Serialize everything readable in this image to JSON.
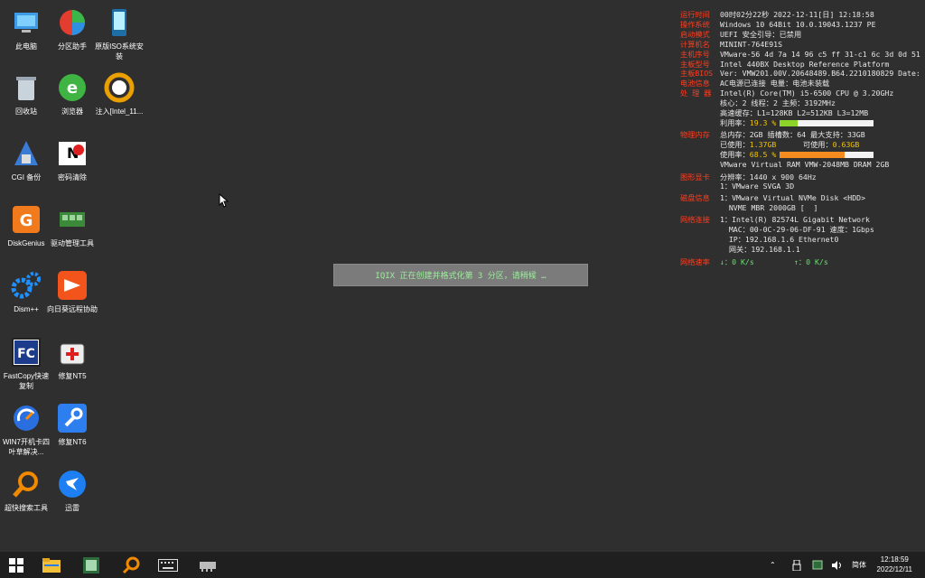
{
  "desktop": {
    "icons": [
      {
        "label": "此电脑"
      },
      {
        "label": "分区助手"
      },
      {
        "label": "原版ISO系统安装"
      },
      {
        "label": "回收站"
      },
      {
        "label": "浏览器"
      },
      {
        "label": "注入[Intel_11..."
      },
      {
        "label": "CGI 备份"
      },
      {
        "label": "密码清除"
      },
      {
        "label": "DiskGenius"
      },
      {
        "label": "驱动管理工具"
      },
      {
        "label": "Dism++"
      },
      {
        "label": "向日葵远程协助"
      },
      {
        "label": "FastCopy快速复制"
      },
      {
        "label": "修复NT5"
      },
      {
        "label": "WIN7开机卡四叶草解决..."
      },
      {
        "label": "修复NT6"
      },
      {
        "label": "超快搜索工具"
      },
      {
        "label": "迅雷"
      }
    ]
  },
  "sysinfo": {
    "runtime_k": "运行时间",
    "runtime_v": "00时02分22秒  2022-12-11[日] 12:18:58",
    "os_k": "操作系统",
    "os_v": "Windows 10 64Bit 10.0.19043.1237 PE",
    "boot_k": "启动模式",
    "boot_v": "UEFI       安全引导：已禁用",
    "pcname_k": "计算机名",
    "pcname_v": "MININT-764E91S",
    "serial_k": "主机序号",
    "serial_v": "VMware-56 4d 7a 14 96 c5 ff 31-c1 6c 3d 0d 51",
    "board_k": "主板型号",
    "board_v": "Intel 440BX Desktop Reference Platform",
    "bios_k": "主板BIOS",
    "bios_v": "Ver: VMW201.00V.20648489.B64.2210180829  Date:",
    "battery_k": "电池信息",
    "battery_v": "AC电源已连接  电量：电池未装载",
    "cpu_k": "处 理 器",
    "cpu_v": "Intel(R) Core(TM) i5-6500 CPU @ 3.20GHz",
    "cpu_cores": "核心：2  线程：2       主频：3192MHz",
    "cpu_cache": "高速缓存：L1=128KB L2=512KB L3=12MB",
    "cpu_usage_label": "利用率：",
    "cpu_usage_val": "19.3 %",
    "cpu_usage_pct": 19.3,
    "mem_k": "物理内存",
    "mem_v": "总内存：2GB 插槽数：64 最大支持：33GB",
    "mem_used_label": "已使用：",
    "mem_used_val": "1.37GB",
    "mem_avail_label": "      可使用：",
    "mem_avail_val": "0.63GB",
    "mem_usage_label": "使用率：",
    "mem_usage_val": "68.5 %",
    "mem_usage_pct": 68.5,
    "mem_model": "VMware Virtual RAM VMW-2048MB DRAM 2GB",
    "gpu_k": "图形显卡",
    "gpu_v": "分辨率：1440 x 900 64Hz",
    "gpu_name": "1：VMware SVGA 3D",
    "disk_k": "磁盘信息",
    "disk_v": "1：VMware Virtual NVMe Disk <HDD>",
    "disk_detail": "  NVME MBR 2000GB [  ]",
    "net_k": "网络连接",
    "net_v": "1：Intel(R) 82574L Gigabit Network",
    "net_mac": "  MAC：00-0C-29-06-DF-91 速度：1Gbps",
    "net_ip": "  IP：192.168.1.6 Ethernet0",
    "net_gw": "  网关：192.168.1.1",
    "speed_k": "网络速率",
    "speed_down": "↓：0 K/s",
    "speed_up": "↑：0 K/s",
    "colors": {
      "key": "#ff3d1f",
      "cpu_bar": "#8cd42a",
      "mem_bar": "#f58a1f",
      "highlight": "#f2c200"
    }
  },
  "message": "IQIX 正在创建并格式化第 3 分区，请稍候 …",
  "taskbar": {
    "items": [
      "start-icon",
      "file-explorer-icon",
      "app-icon",
      "search-tool-icon",
      "keyboard-icon",
      "chip-icon"
    ],
    "tray_lang": "简体",
    "time": "12:18:59",
    "date": "2022/12/11"
  }
}
